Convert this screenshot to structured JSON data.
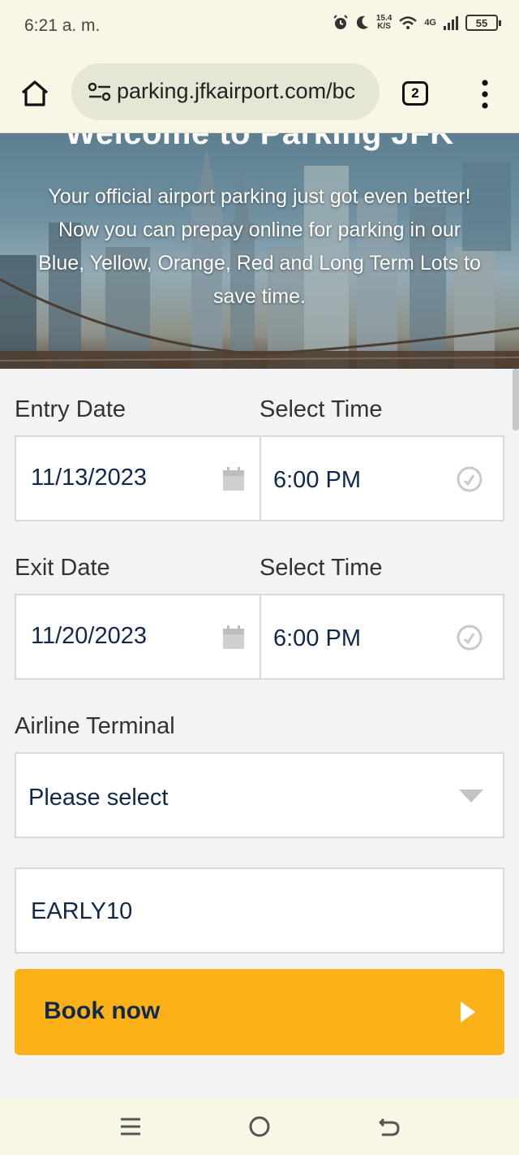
{
  "status_bar": {
    "time": "6:21 a. m.",
    "speed_value": "15.4",
    "speed_unit": "K/S",
    "network": "4G",
    "battery": "55"
  },
  "browser": {
    "url": "parking.jfkairport.com/bc",
    "tab_count": "2"
  },
  "hero": {
    "title": "Welcome to Parking JFK",
    "text": "Your official airport parking just got even better! Now you can prepay online for parking in our Blue, Yellow, Orange, Red and Long Term Lots to save time."
  },
  "form": {
    "entry_date_label": "Entry Date",
    "entry_time_label": "Select Time",
    "entry_date_value": "11/13/2023",
    "entry_time_value": "6:00 PM",
    "exit_date_label": "Exit Date",
    "exit_time_label": "Select Time",
    "exit_date_value": "11/20/2023",
    "exit_time_value": "6:00 PM",
    "terminal_label": "Airline Terminal",
    "terminal_value": "Please select",
    "promo_value": "EARLY10",
    "book_label": "Book now"
  },
  "colors": {
    "accent": "#fbb117",
    "text_navy": "#10284c"
  }
}
